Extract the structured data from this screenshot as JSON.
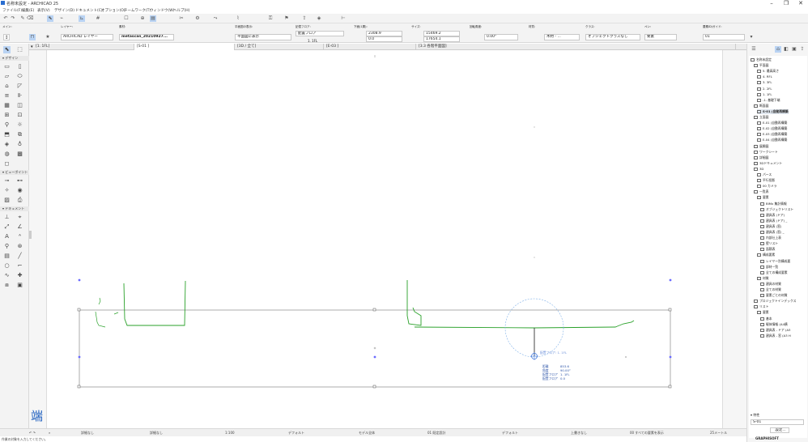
{
  "window": {
    "title": "名称未設定 - ARCHICAD 25"
  },
  "menu": [
    "ファイル(F)",
    "編集(E)",
    "表示(V)",
    "デザイン(D)",
    "ドキュメント(C)",
    "オプション(O)",
    "チームワーク(T)",
    "ウィンドウ(W)",
    "ヘルプ(H)"
  ],
  "toolbar": {
    "layer_header": "レイヤー:",
    "layer_value": "ARCHICAD レイヤー",
    "floor_header": "素材:",
    "floor_value": "metascan_20210927...",
    "view_header": "平面図の表示:",
    "view_value": "平面図に表示",
    "home_header": "記憶フロア:",
    "home_value": "配置フロア",
    "floor_sub": "1. 1FL",
    "x_header": "下面(1層):",
    "x_value": "2308.9",
    "x_value2": "0.0",
    "size_header": "サイズ:",
    "size_w": "15469.2",
    "size_h": "17654.1",
    "rot_header": "回転角度:",
    "rot_value": "0.00°",
    "mat_header": "材質:",
    "mat_value": "木材 - ...",
    "class_header": "クラス:",
    "class_value": "オブジェクトクラスなし",
    "pen_header": "ペン:",
    "pen_value": "要素",
    "id_header": "要素ID/ガイド:",
    "id_value": "01"
  },
  "left_panel": {
    "design_label": "▾ デザイン",
    "viewpoint_label": "▾ ビューポイント",
    "document_label": "▾ ドキュメント"
  },
  "tabs": [
    {
      "label": "[1. 1FL]",
      "active": false
    },
    {
      "label": "[S-01 ]",
      "active": true
    },
    {
      "label": "[3D / 全て]",
      "active": false
    },
    {
      "label": "[E-03 ]",
      "active": false
    },
    {
      "label": "[3.3 各階平面図]",
      "active": false
    }
  ],
  "canvas": {
    "dim_label": "配置フロア: 1. 1FL",
    "readout": [
      {
        "k": "距離",
        "v": "853.6"
      },
      {
        "k": "角度",
        "v": "90.00°"
      },
      {
        "k": "配置フロア",
        "v": "1. 1FL"
      },
      {
        "k": "配置フロア",
        "v": "0.0"
      }
    ]
  },
  "navigator": {
    "tree": [
      "名称未設定",
      "平面図",
      "5. 最高高さ",
      "4. RFL",
      "3. 3FL",
      "2. 2FL",
      "1. 1FL",
      "-1. 基礎下端",
      "断面図",
      "S-01 (自動再構築",
      "立面図",
      "E-01 (自動再構築",
      "E-02 (自動再構築",
      "E-03 (自動再構築",
      "E-04 (自動再構築",
      "展開図",
      "ワークシート",
      "詳細図",
      "3Dドキュメント",
      "3D",
      "パース",
      "平行投影",
      "00 カメラ",
      "一覧表",
      "要素",
      "BIMx 集計情報",
      "オブジェクトリスト",
      "建具表 (ドア)",
      "建具表 (ドア) _",
      "建具表 (窓)",
      "建具表 (窓) _",
      "内部仕上表",
      "壁リスト",
      "面積表",
      "構成要素",
      "レイヤー別構成要",
      "部材一覧",
      "全ての構成要素",
      "材質",
      "建具の材質",
      "全ての材質",
      "要素ごとの材質",
      "プロジェクトインデックス",
      "リスト",
      "要素",
      "基本",
      "駆体情報 (A4横",
      "建具表 - ドア (A3",
      "建具表 - 窓 (A3 H"
    ],
    "props_label": "▾ 特性",
    "props_id": "S-01",
    "settings_button": "設定...",
    "brand": "GRAPHISOFT"
  },
  "status": {
    "undo": "5",
    "zoom": "1:100",
    "pen_set": "デフォルト",
    "model": "モデル全体",
    "renovation": "01 既定設計",
    "struct": "デフォルト",
    "override": "上書きなし",
    "filter": "00 すべての要素を表示",
    "dim": "25メートル",
    "nav1": "詳細なし",
    "nav2": "詳細なし"
  },
  "footer": {
    "hint": "作業の対象を入力してください。"
  },
  "logo_text": "端"
}
